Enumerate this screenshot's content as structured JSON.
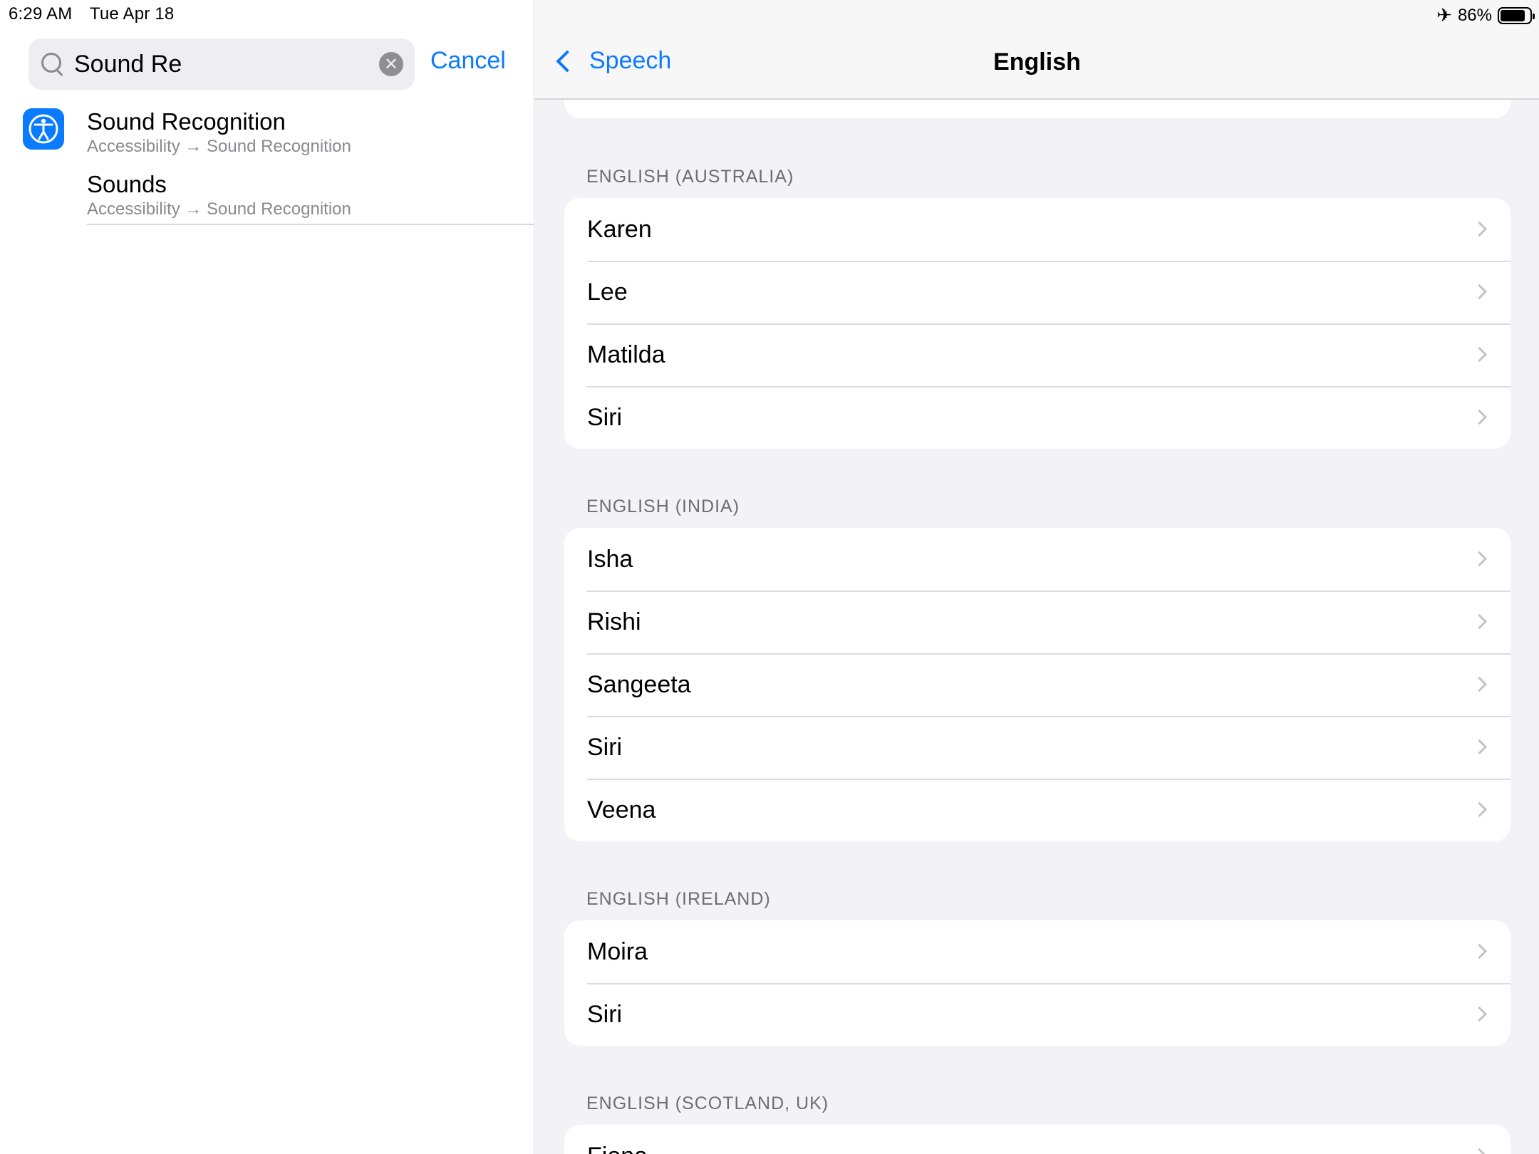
{
  "status_bar": {
    "time": "6:29 AM",
    "date": "Tue Apr 18",
    "battery_percent": "86%",
    "battery_level": 0.86,
    "airplane_icon": "airplane-icon"
  },
  "search": {
    "query": "Sound Re",
    "cancel_label": "Cancel"
  },
  "results": [
    {
      "title": "Sound Recognition",
      "path": "Accessibility → Sound Recognition",
      "icon": "accessibility-icon"
    },
    {
      "title": "Sounds",
      "path": "Accessibility → Sound Recognition"
    }
  ],
  "nav": {
    "back_label": "Speech",
    "title": "English"
  },
  "sections": [
    {
      "header": "ENGLISH (AUSTRALIA)",
      "items": [
        "Karen",
        "Lee",
        "Matilda",
        "Siri"
      ]
    },
    {
      "header": "ENGLISH (INDIA)",
      "items": [
        "Isha",
        "Rishi",
        "Sangeeta",
        "Siri",
        "Veena"
      ]
    },
    {
      "header": "ENGLISH (IRELAND)",
      "items": [
        "Moira",
        "Siri"
      ]
    },
    {
      "header": "ENGLISH (SCOTLAND, UK)",
      "items": [
        "Fiona"
      ]
    }
  ],
  "colors": {
    "accent": "#0a7aff",
    "background": "#f2f2f7"
  }
}
